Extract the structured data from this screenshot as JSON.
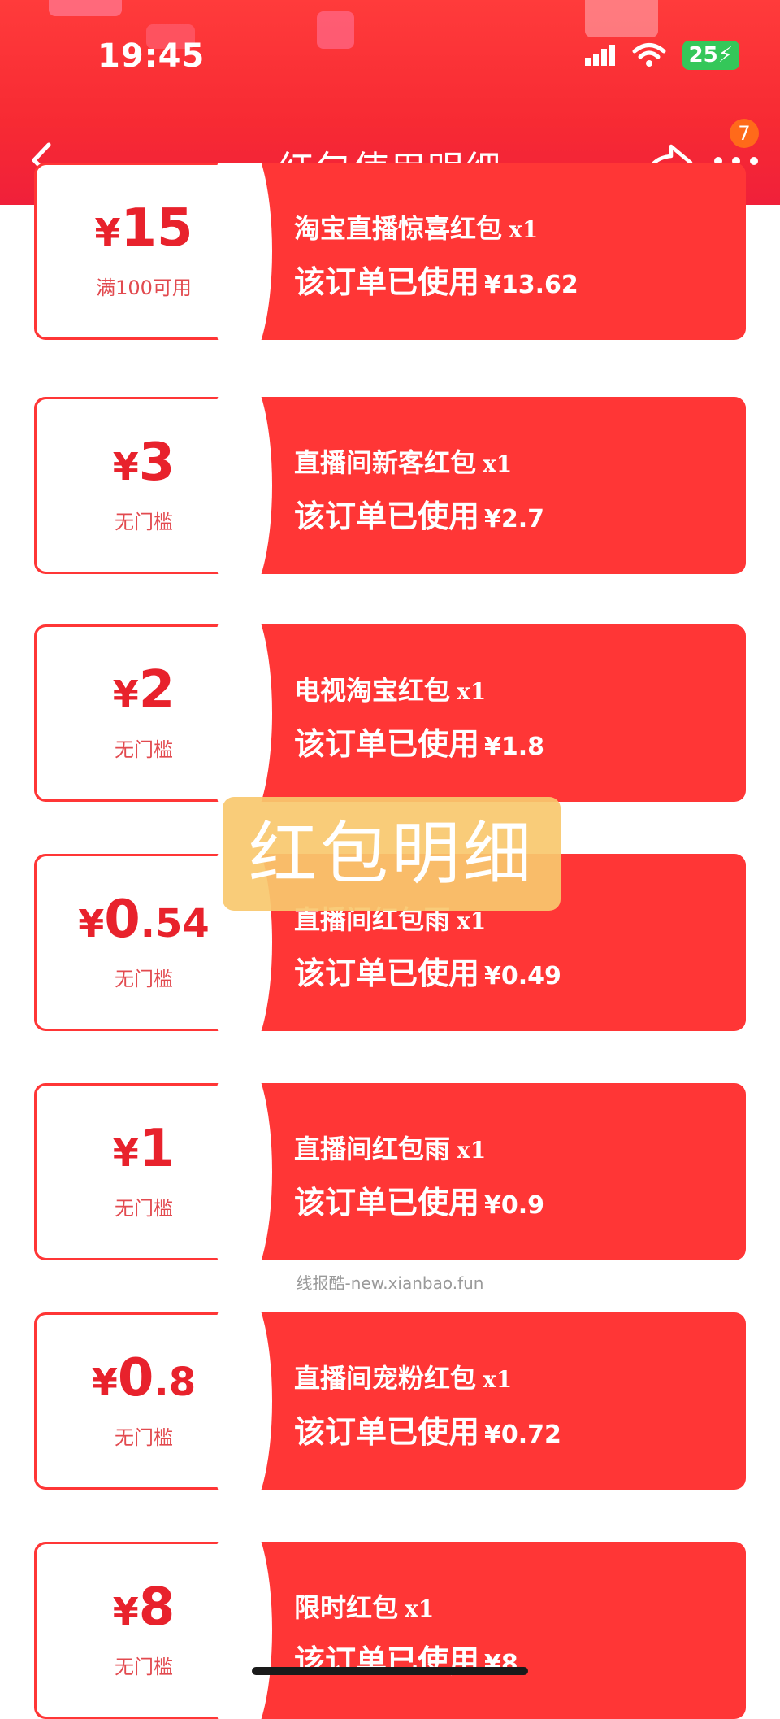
{
  "status": {
    "time": "19:45",
    "battery": "25"
  },
  "nav": {
    "title": "红包使用明细",
    "badge": "7"
  },
  "cards": [
    {
      "yen": "¥",
      "amount": "15",
      "decimal": "",
      "condition": "满100可用",
      "name": "淘宝直播惊喜红包",
      "qty": "x1",
      "used_label": "该订单已使用",
      "used_amount": "¥13.62"
    },
    {
      "yen": "¥",
      "amount": "3",
      "decimal": "",
      "condition": "无门槛",
      "name": "直播间新客红包",
      "qty": "x1",
      "used_label": "该订单已使用",
      "used_amount": "¥2.7"
    },
    {
      "yen": "¥",
      "amount": "2",
      "decimal": "",
      "condition": "无门槛",
      "name": "电视淘宝红包",
      "qty": "x1",
      "used_label": "该订单已使用",
      "used_amount": "¥1.8"
    },
    {
      "yen": "¥",
      "amount": "0",
      "decimal": ".54",
      "condition": "无门槛",
      "name": "直播间红包雨",
      "qty": "x1",
      "used_label": "该订单已使用",
      "used_amount": "¥0.49"
    },
    {
      "yen": "¥",
      "amount": "1",
      "decimal": "",
      "condition": "无门槛",
      "name": "直播间红包雨",
      "qty": "x1",
      "used_label": "该订单已使用",
      "used_amount": "¥0.9"
    },
    {
      "yen": "¥",
      "amount": "0",
      "decimal": ".8",
      "condition": "无门槛",
      "name": "直播间宠粉红包",
      "qty": "x1",
      "used_label": "该订单已使用",
      "used_amount": "¥0.72"
    },
    {
      "yen": "¥",
      "amount": "8",
      "decimal": "",
      "condition": "无门槛",
      "name": "限时红包",
      "qty": "x1",
      "used_label": "该订单已使用",
      "used_amount": "¥8"
    }
  ],
  "overlay": {
    "watermark": "红包明细",
    "site": "线报酷-new.xianbao.fun"
  }
}
